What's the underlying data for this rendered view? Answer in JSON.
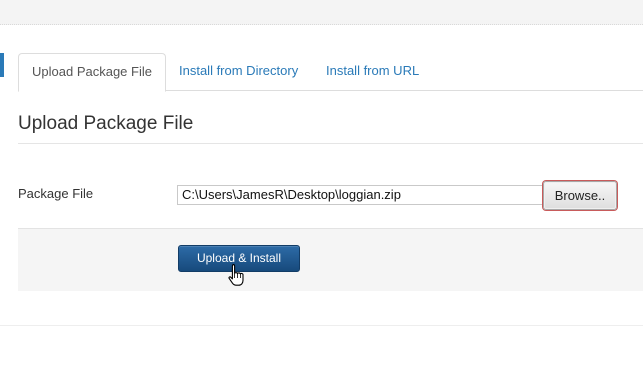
{
  "tabs": [
    {
      "label": "Upload Package File",
      "active": true
    },
    {
      "label": "Install from Directory",
      "active": false
    },
    {
      "label": "Install from URL",
      "active": false
    }
  ],
  "section": {
    "title": "Upload Package File"
  },
  "form": {
    "package_file_label": "Package File",
    "package_file_value": "C:\\Users\\JamesR\\Desktop\\loggian.zip",
    "browse_label": "Browse..",
    "install_label": "Upload & Install"
  },
  "icons": {
    "cursor": "hand-pointer-icon"
  },
  "colors": {
    "link": "#2a7ab8",
    "primary_button": "#1f5a93",
    "panel": "#f5f5f5"
  }
}
